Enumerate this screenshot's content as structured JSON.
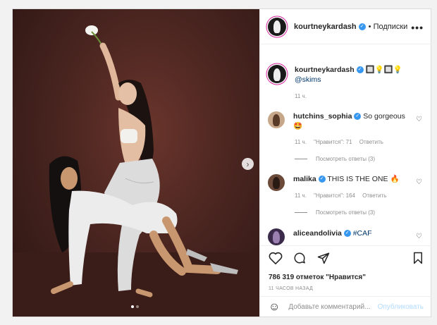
{
  "post": {
    "author": "kourtneykardash",
    "follow_label": "• Подписки",
    "more_label": "•••"
  },
  "caption": {
    "username": "kourtneykardash",
    "emojis": "🔲💡🔲💡",
    "mention": "@skims",
    "time": "11 ч."
  },
  "comments": [
    {
      "username": "hutchins_sophia",
      "text": "So gorgeous",
      "emoji": "🤩",
      "time": "11 ч.",
      "likes": "\"Нравится\": 71",
      "reply_label": "Ответить",
      "view_replies": "Посмотреть ответы (3)"
    },
    {
      "username": "malika",
      "text": "THIS IS THE ONE",
      "emoji": "🔥",
      "time": "11 ч.",
      "likes": "\"Нравится\": 164",
      "reply_label": "Ответить",
      "view_replies": "Посмотреть ответы (3)"
    },
    {
      "username": "aliceandolivia",
      "text": "#CAF"
    }
  ],
  "stats": {
    "likes": "786 319 отметок \"Нравится\"",
    "time_ago": "11 ЧАСОВ НАЗАД"
  },
  "composer": {
    "placeholder": "Добавьте комментарий...",
    "post_label": "Опубликовать"
  },
  "carousel": {
    "dot_count": 2,
    "active_index": 0
  }
}
